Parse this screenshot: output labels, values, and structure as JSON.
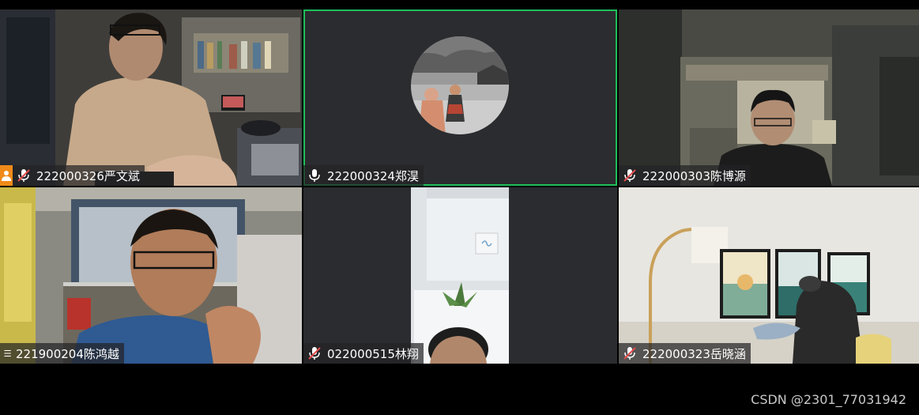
{
  "participants": [
    {
      "name": "222000326严文斌",
      "mic": "muted",
      "is_host": true
    },
    {
      "name": "222000324郑淏",
      "mic": "on",
      "active_speaker": true
    },
    {
      "name": "222000303陈博源",
      "mic": "muted"
    },
    {
      "name": "221900204陈鸿越",
      "mic": "menu"
    },
    {
      "name": "022000515林翔",
      "mic": "muted"
    },
    {
      "name": "222000323岳晓涵",
      "mic": "muted"
    }
  ],
  "watermark": "CSDN @2301_77031942",
  "icons": {
    "muted": "mic-muted-icon",
    "on": "mic-icon",
    "host": "host-icon",
    "menu": "menu-icon",
    "avatar": "profile-avatar"
  },
  "colors": {
    "active_border": "#1fbf5a",
    "host_badge": "#f08a19",
    "muted_slash": "#e24b4b",
    "tile_bg": "#2b2c2f"
  }
}
